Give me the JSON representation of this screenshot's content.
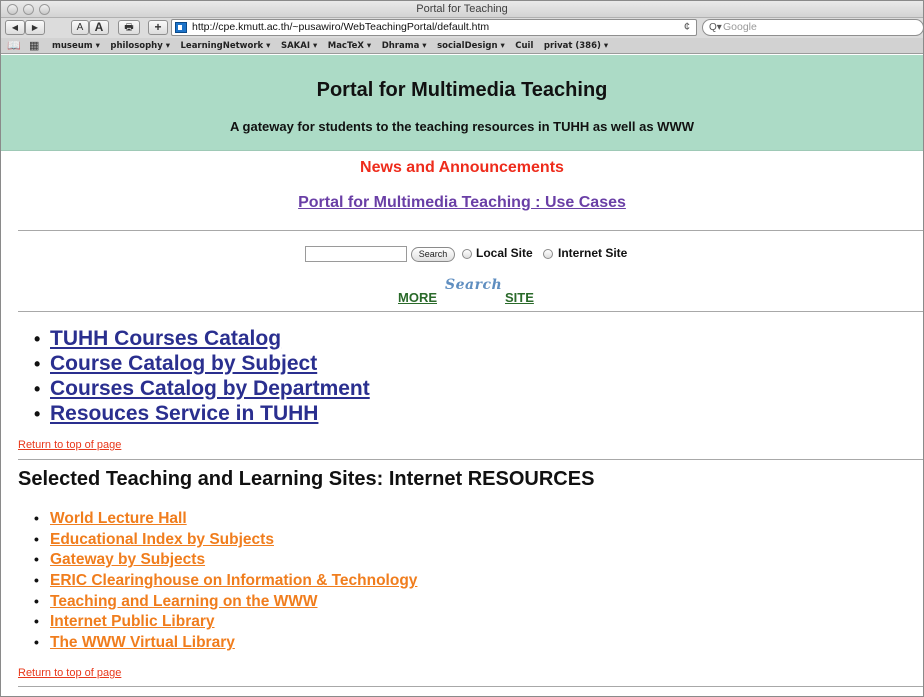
{
  "window": {
    "title": "Portal for Teaching"
  },
  "toolbar": {
    "back_glyph": "◀",
    "forward_glyph": "▶",
    "text_small": "A",
    "text_large": "A",
    "print_glyph": "🖶",
    "add_glyph": "+",
    "url": "http://cpe.kmutt.ac.th/~pusawiro/WebTeachingPortal/default.htm",
    "reload_glyph": "¢",
    "search_placeholder": "Google",
    "search_glyph": "Q▾"
  },
  "bookmarks": {
    "book_glyph": "📖",
    "grid_glyph": "▦",
    "items": [
      "museum ▾",
      "philosophy ▾",
      "LearningNetwork ▾",
      "SAKAI ▾",
      "MacTeX ▾",
      "Dhrama ▾",
      "socialDesign ▾",
      "Cuil",
      "privat (386) ▾"
    ]
  },
  "header": {
    "title": "Portal for Multimedia Teaching",
    "subtitle": "A gateway for students to the teaching resources in TUHH as well as WWW"
  },
  "news": "News and Announcements",
  "use_cases_link": "Portal for Multimedia Teaching : Use Cases",
  "search": {
    "input_value": "",
    "button_label": "Search",
    "radio_local": "Local Site",
    "radio_internet": "Internet Site",
    "more_prefix": "MORE",
    "logo_text": "Search",
    "more_suffix": "SITE"
  },
  "tuhh_links": [
    "TUHH Courses Catalog",
    "Course Catalog by Subject",
    "Courses Catalog by Department",
    "Resouces Service in TUHH"
  ],
  "return_top": "Return to top of page",
  "resources_heading": "Selected Teaching and Learning Sites: Internet RESOURCES",
  "resource_links": [
    "World Lecture Hall",
    "Educational Index by Subjects",
    "Gateway by Subjects",
    "ERIC Clearinghouse on Information & Technology",
    "Teaching and Learning on the WWW",
    "Internet Public Library",
    "The WWW Virtual Library"
  ],
  "colors": {
    "header_bg": "#acdbc6",
    "news": "#ee2c1c",
    "use_cases": "#6a3fa6",
    "tuhh_links": "#2a2f8f",
    "resource_links": "#f07d1d",
    "more_site": "#2a6a2a"
  }
}
